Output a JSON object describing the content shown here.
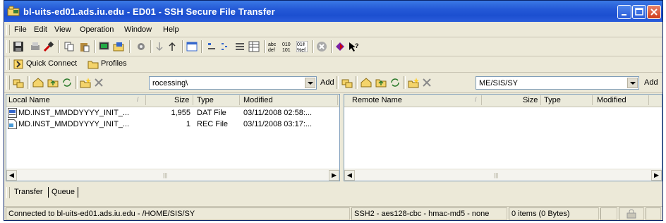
{
  "window": {
    "title": "bl-uits-ed01.ads.iu.edu - ED01 - SSH Secure File Transfer"
  },
  "menu": [
    "File",
    "Edit",
    "View",
    "Operation",
    "Window",
    "Help"
  ],
  "shortcuts": {
    "quick_connect": "Quick Connect",
    "profiles": "Profiles"
  },
  "local": {
    "path": "rocessing\\",
    "add_label": "Add",
    "columns": {
      "name": "Local Name",
      "size": "Size",
      "type": "Type",
      "modified": "Modified"
    },
    "rows": [
      {
        "name": "MD.INST_MMDDYYYY_INIT_...",
        "size": "1,955",
        "type": "DAT File",
        "modified": "03/11/2008 02:58:..."
      },
      {
        "name": "MD.INST_MMDDYYYY_INIT_...",
        "size": "1",
        "type": "REC File",
        "modified": "03/11/2008 03:17:..."
      }
    ]
  },
  "remote": {
    "path": "ME/SIS/SY",
    "add_label": "Add",
    "columns": {
      "name": "Remote Name",
      "size": "Size",
      "type": "Type",
      "modified": "Modified"
    },
    "rows": []
  },
  "tabs": {
    "transfer": "Transfer",
    "queue": "Queue"
  },
  "status": {
    "connection": "Connected to bl-uits-ed01.ads.iu.edu - /HOME/SIS/SY",
    "cipher": "SSH2 - aes128-cbc - hmac-md5 - none",
    "items": "0 items (0 Bytes)"
  },
  "colors": {
    "titlebar": "#2459d6",
    "chrome": "#ece9d8",
    "border": "#7f9db9"
  }
}
